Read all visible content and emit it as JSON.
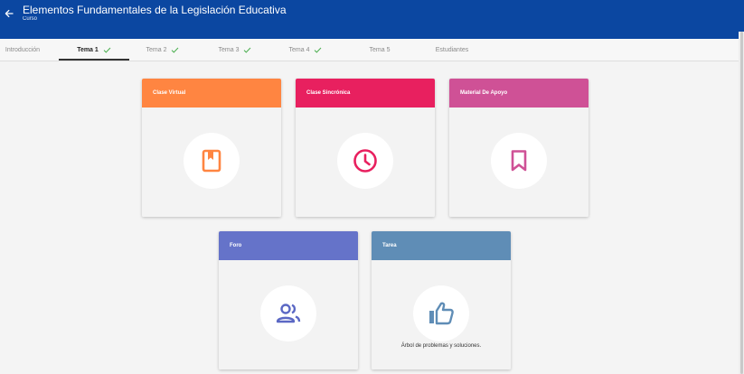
{
  "header": {
    "title": "Elementos Fundamentales de la Legislación Educativa",
    "subtitle": "Curso"
  },
  "tabs": [
    {
      "label": "Introducción",
      "check": false
    },
    {
      "label": "Tema 1",
      "check": true,
      "active": true
    },
    {
      "label": "Tema 2",
      "check": true
    },
    {
      "label": "Tema 3",
      "check": true
    },
    {
      "label": "Tema 4",
      "check": true
    },
    {
      "label": "Tema 5",
      "check": false
    },
    {
      "label": "Estudiantes",
      "check": false
    }
  ],
  "cards": [
    {
      "title": "Clase Virtual",
      "icon": "book-icon",
      "color": "#ff8541"
    },
    {
      "title": "Clase Sincrónica",
      "icon": "clock-icon",
      "color": "#e8205f"
    },
    {
      "title": "Material De Apoyo",
      "icon": "bookmark-icon",
      "color": "#cf5196"
    },
    {
      "title": "Foro",
      "icon": "people-icon",
      "color": "#6573c9"
    },
    {
      "title": "Tarea",
      "icon": "thumbs-up-icon",
      "color": "#5f8db6",
      "note": "Árbol de problemas y soluciones."
    }
  ],
  "colors": {
    "appbar": "#0b47a1",
    "check": "#4caf50"
  }
}
